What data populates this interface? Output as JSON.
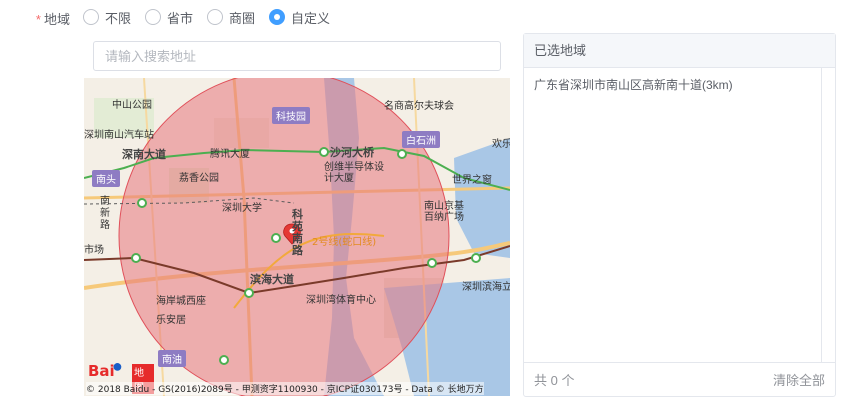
{
  "form": {
    "required_mark": "*",
    "label": "地域"
  },
  "region_options": [
    {
      "label": "不限",
      "checked": false
    },
    {
      "label": "省市",
      "checked": false
    },
    {
      "label": "商圈",
      "checked": false
    },
    {
      "label": "自定义",
      "checked": true
    }
  ],
  "search": {
    "value": "",
    "placeholder": "请输入搜索地址"
  },
  "map": {
    "labels": {
      "zhongshan_park": "中山公园",
      "kejiyuan": "科技园",
      "mingshang": "名商高尔夫球会",
      "bus_station": "深圳南山汽车站",
      "shennan_road": "深南大道",
      "tencent": "腾讯大厦",
      "shahe": "沙河大桥",
      "baishizhou": "白石洲",
      "huanle": "欢乐",
      "nantou": "南头",
      "lichi_park": "荔香公园",
      "chuangwei": "创维半导体设计大厦",
      "window_world": "世界之窗",
      "nanxin_road": "南新路",
      "szu": "深圳大学",
      "keyuan_road": "科苑南路",
      "nanshan_jingji": "南山京基百纳广场",
      "market": "市场",
      "line2": "2号线(蛇口线)",
      "binhai": "滨海大道",
      "shenzhen_bay": "深圳滨海立",
      "haian": "海岸城西座",
      "sports": "深圳湾体育中心",
      "leanju": "乐安居",
      "nanyou": "南油"
    },
    "logo": {
      "brand": "Bai",
      "paw": "du",
      "suffix": "地图"
    },
    "copyright": "© 2018 Baidu - GS(2016)2089号 - 甲测资字1100930 - 京ICP证030173号 - Data © 长地万方",
    "colors": {
      "circle_fill": "#e8777e",
      "circle_stroke": "#e0505a",
      "water": "#a9c7e6",
      "green_line": "#4caf50",
      "metro_line": "#7a3a2a",
      "road": "#f6c97a",
      "badge_purple": "#8e7cc3",
      "pin": "#e53935"
    }
  },
  "selected": {
    "title": "已选地域",
    "items": [
      "广东省深圳市南山区高新南十道(3km)"
    ],
    "count_text": "共 0 个",
    "clear_label": "清除全部"
  },
  "colors": {
    "primary": "#409eff",
    "required": "#f56c6c"
  }
}
